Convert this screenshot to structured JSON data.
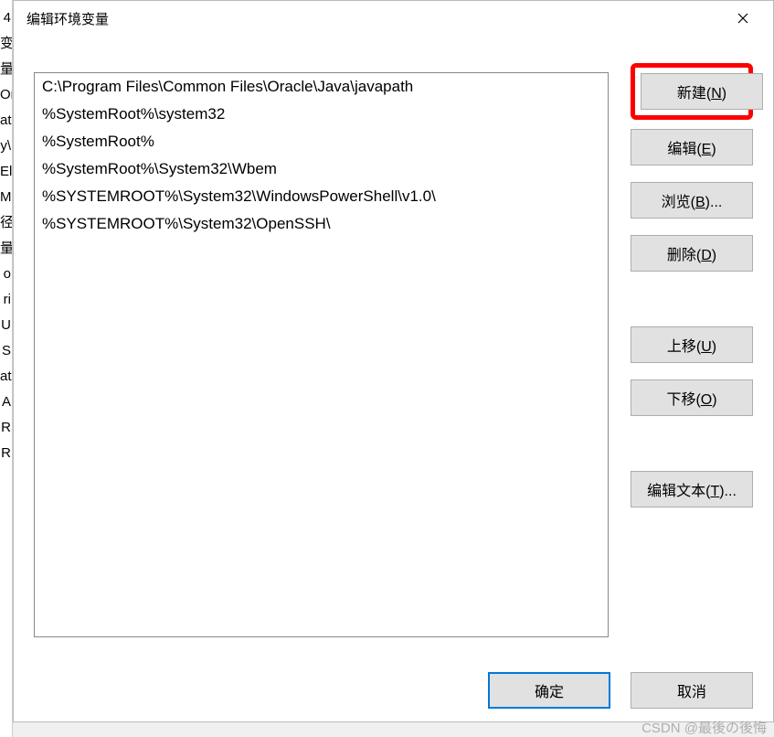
{
  "background_fragments": [
    "4",
    " ",
    "变量",
    "On",
    "at",
    "y\\",
    "El",
    "M",
    " ",
    " ",
    "径",
    " ",
    "量",
    "o",
    "ri",
    "U",
    "S",
    "at",
    "A",
    "R",
    "R"
  ],
  "titlebar": {
    "title": "编辑环境变量"
  },
  "list": {
    "items": [
      "C:\\Program Files\\Common Files\\Oracle\\Java\\javapath",
      "%SystemRoot%\\system32",
      "%SystemRoot%",
      "%SystemRoot%\\System32\\Wbem",
      "%SYSTEMROOT%\\System32\\WindowsPowerShell\\v1.0\\",
      "%SYSTEMROOT%\\System32\\OpenSSH\\"
    ],
    "selected_index": -1
  },
  "buttons": {
    "new_pre": "新建(",
    "new_key": "N",
    "new_post": ")",
    "edit_pre": "编辑(",
    "edit_key": "E",
    "edit_post": ")",
    "browse_pre": "浏览(",
    "browse_key": "B",
    "browse_post": ")...",
    "delete_pre": "删除(",
    "delete_key": "D",
    "delete_post": ")",
    "moveup_pre": "上移(",
    "moveup_key": "U",
    "moveup_post": ")",
    "movedown_pre": "下移(",
    "movedown_key": "O",
    "movedown_post": ")",
    "edittext_pre": "编辑文本(",
    "edittext_key": "T",
    "edittext_post": ")...",
    "ok": "确定",
    "cancel": "取消"
  },
  "watermark": "CSDN @最後の後悔",
  "highlight": {
    "target": "new-button",
    "color": "#ff0000"
  }
}
